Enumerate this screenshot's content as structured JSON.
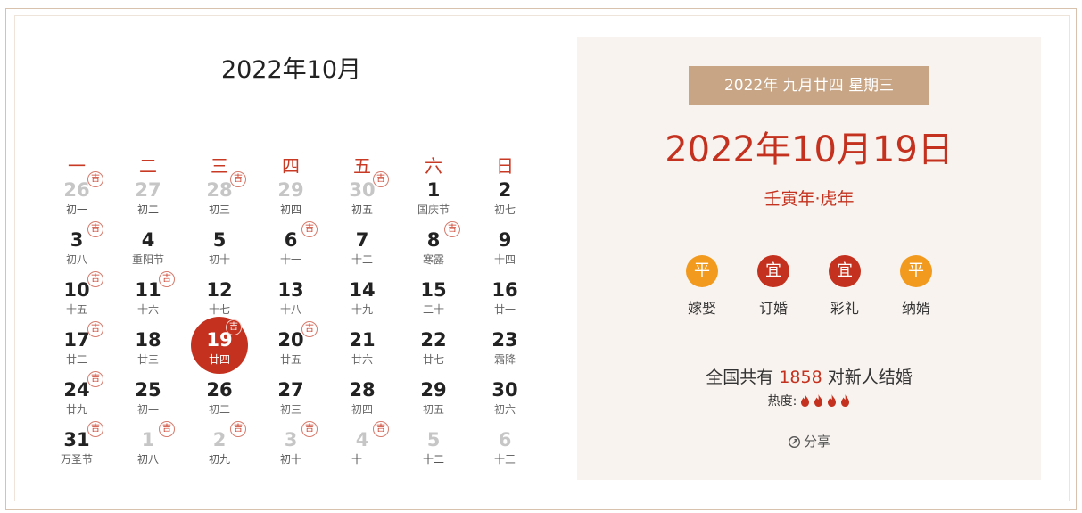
{
  "calendar": {
    "month_title": "2022年10月",
    "weekdays": [
      "一",
      "二",
      "三",
      "四",
      "五",
      "六",
      "日"
    ],
    "lucky_mark": "吉",
    "days": [
      {
        "day": "26",
        "lunar": "初一",
        "ji": true,
        "dim": true
      },
      {
        "day": "27",
        "lunar": "初二",
        "ji": false,
        "dim": true
      },
      {
        "day": "28",
        "lunar": "初三",
        "ji": true,
        "dim": true
      },
      {
        "day": "29",
        "lunar": "初四",
        "ji": false,
        "dim": true
      },
      {
        "day": "30",
        "lunar": "初五",
        "ji": true,
        "dim": true
      },
      {
        "day": "1",
        "lunar": "国庆节",
        "ji": false,
        "dim": false
      },
      {
        "day": "2",
        "lunar": "初七",
        "ji": false,
        "dim": false
      },
      {
        "day": "3",
        "lunar": "初八",
        "ji": true,
        "dim": false
      },
      {
        "day": "4",
        "lunar": "重阳节",
        "ji": false,
        "dim": false
      },
      {
        "day": "5",
        "lunar": "初十",
        "ji": false,
        "dim": false
      },
      {
        "day": "6",
        "lunar": "十一",
        "ji": true,
        "dim": false
      },
      {
        "day": "7",
        "lunar": "十二",
        "ji": false,
        "dim": false
      },
      {
        "day": "8",
        "lunar": "寒露",
        "ji": true,
        "dim": false
      },
      {
        "day": "9",
        "lunar": "十四",
        "ji": false,
        "dim": false
      },
      {
        "day": "10",
        "lunar": "十五",
        "ji": true,
        "dim": false
      },
      {
        "day": "11",
        "lunar": "十六",
        "ji": true,
        "dim": false
      },
      {
        "day": "12",
        "lunar": "十七",
        "ji": false,
        "dim": false
      },
      {
        "day": "13",
        "lunar": "十八",
        "ji": false,
        "dim": false
      },
      {
        "day": "14",
        "lunar": "十九",
        "ji": false,
        "dim": false
      },
      {
        "day": "15",
        "lunar": "二十",
        "ji": false,
        "dim": false
      },
      {
        "day": "16",
        "lunar": "廿一",
        "ji": false,
        "dim": false
      },
      {
        "day": "17",
        "lunar": "廿二",
        "ji": true,
        "dim": false
      },
      {
        "day": "18",
        "lunar": "廿三",
        "ji": false,
        "dim": false
      },
      {
        "day": "19",
        "lunar": "廿四",
        "ji": true,
        "dim": false,
        "selected": true
      },
      {
        "day": "20",
        "lunar": "廿五",
        "ji": true,
        "dim": false
      },
      {
        "day": "21",
        "lunar": "廿六",
        "ji": false,
        "dim": false
      },
      {
        "day": "22",
        "lunar": "廿七",
        "ji": false,
        "dim": false
      },
      {
        "day": "23",
        "lunar": "霜降",
        "ji": false,
        "dim": false
      },
      {
        "day": "24",
        "lunar": "廿九",
        "ji": true,
        "dim": false
      },
      {
        "day": "25",
        "lunar": "初一",
        "ji": false,
        "dim": false
      },
      {
        "day": "26",
        "lunar": "初二",
        "ji": false,
        "dim": false
      },
      {
        "day": "27",
        "lunar": "初三",
        "ji": false,
        "dim": false
      },
      {
        "day": "28",
        "lunar": "初四",
        "ji": false,
        "dim": false
      },
      {
        "day": "29",
        "lunar": "初五",
        "ji": false,
        "dim": false
      },
      {
        "day": "30",
        "lunar": "初六",
        "ji": false,
        "dim": false
      },
      {
        "day": "31",
        "lunar": "万圣节",
        "ji": true,
        "dim": false
      },
      {
        "day": "1",
        "lunar": "初八",
        "ji": true,
        "dim": true
      },
      {
        "day": "2",
        "lunar": "初九",
        "ji": true,
        "dim": true
      },
      {
        "day": "3",
        "lunar": "初十",
        "ji": true,
        "dim": true
      },
      {
        "day": "4",
        "lunar": "十一",
        "ji": true,
        "dim": true
      },
      {
        "day": "5",
        "lunar": "十二",
        "ji": false,
        "dim": true
      },
      {
        "day": "6",
        "lunar": "十三",
        "ji": false,
        "dim": true
      }
    ]
  },
  "detail": {
    "lunar_banner": "2022年 九月廿四 星期三",
    "date": "2022年10月19日",
    "ganzhi": "壬寅年·虎年",
    "activities": [
      {
        "mark": "平",
        "label": "嫁娶",
        "color": "#f29a1e"
      },
      {
        "mark": "宜",
        "label": "订婚",
        "color": "#c4311e"
      },
      {
        "mark": "宜",
        "label": "彩礼",
        "color": "#c4311e"
      },
      {
        "mark": "平",
        "label": "纳婿",
        "color": "#f29a1e"
      }
    ],
    "count_prefix": "全国共有",
    "count": "1858",
    "count_suffix": "对新人结婚",
    "heat_label": "热度:",
    "heat_level": 4,
    "share_label": "分享"
  },
  "colors": {
    "accent": "#c4311e",
    "banner": "#c8a585",
    "panel": "#f8f3ef",
    "neutral": "#f29a1e"
  }
}
